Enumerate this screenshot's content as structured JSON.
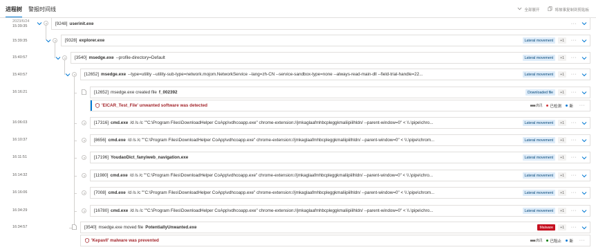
{
  "tabs": [
    {
      "label": "进程树",
      "active": true
    },
    {
      "label": "警报时间线",
      "active": false
    }
  ],
  "toolbar": {
    "expand_all": "全部展开",
    "copy_to_clipboard": "将故事复制到剪贴板"
  },
  "colors": {
    "accent": "#0078d4",
    "badge_bg": "#deecf9",
    "malware_badge": "#c50f1f",
    "alert_title": "#a4262c",
    "status_red": "#d13438",
    "status_green": "#107c10",
    "status_blue": "#0078d4"
  },
  "rows": [
    {
      "date": "2023/6/24",
      "time": "15:39:35",
      "pid": "[9248]",
      "name": "userinit.exe",
      "args": "",
      "badge": "",
      "plus": ""
    },
    {
      "time": "15:39:35",
      "pid": "[9328]",
      "name": "explorer.exe",
      "args": "",
      "badge": "Lateral movement",
      "plus": "+1"
    },
    {
      "time": "15:40:57",
      "pid": "[3540]",
      "name": "msedge.exe",
      "args": "--profile-directory=Default",
      "badge": "Lateral movement",
      "plus": "+1"
    },
    {
      "time": "15:40:57",
      "pid": "[12652]",
      "name": "msedge.exe",
      "args": "--type=utility --utility-sub-type=network.mojom.NetworkService --lang=zh-CN --service-sandbox-type=none --always-read-main-dll --field-trial-handle=22...",
      "badge": "Lateral movement",
      "plus": "+1"
    },
    {
      "time": "16:16:21",
      "pid": "[12652]",
      "name": "",
      "prefix": "msedge.exe created file",
      "target": "f_002392",
      "badge": "Downloaded file",
      "plus": "+1"
    },
    {
      "alert": true,
      "title": "'EICAR_Test_File' unwanted software was detected",
      "severity": "■■■ 高讯",
      "status": "已检测",
      "extra": "新"
    },
    {
      "time": "16:06:03",
      "pid": "[17316]",
      "name": "cmd.exe",
      "args": "/d /s /c \"\"C:\\Program Files\\DownloadHelper CoApp\\vdhcoapp.exe\" chrome-extension://jmkaglaafmhbcpleggkmaliipiilhldn/ --parent-window=0\" < \\\\.\\pipe\\chro...",
      "badge": "Lateral movement",
      "plus": "+1"
    },
    {
      "time": "16:10:37",
      "pid": "[8656]",
      "name": "cmd.exe",
      "args": "/d /s /c \"\"C:\\Program Files\\DownloadHelper CoApp\\vdhcoapp.exe\" chrome-extension://jmkaglaafmhbcpleggkmaliipiilhldn/ --parent-window=0\" < \\\\.\\pipe\\chrom...",
      "badge": "Lateral movement",
      "plus": "+1"
    },
    {
      "time": "16:11:51",
      "pid": "[17196]",
      "name": "YoudaoDict_fanyiweb_navigation.exe",
      "args": "",
      "badge": "Lateral movement",
      "plus": "+1"
    },
    {
      "time": "16:14:32",
      "pid": "[11980]",
      "name": "cmd.exe",
      "args": "/d /s /c \"\"C:\\Program Files\\DownloadHelper CoApp\\vdhcoapp.exe\" chrome-extension://jmkaglaafmhbcpleggkmaliipiilhldn/ --parent-window=0\" < \\\\.\\pipe\\chro...",
      "badge": "Lateral movement",
      "plus": "+1"
    },
    {
      "time": "16:16:06",
      "pid": "[7008]",
      "name": "cmd.exe",
      "args": "/d /s /c \"\"C:\\Program Files\\DownloadHelper CoApp\\vdhcoapp.exe\" chrome-extension://jmkaglaafmhbcpleggkmaliipiilhldn/ --parent-window=0\" < \\\\.\\pipe\\chrom...",
      "badge": "Lateral movement",
      "plus": "+1"
    },
    {
      "time": "16:34:29",
      "pid": "[16780]",
      "name": "cmd.exe",
      "args": "/d /s /c \"\"C:\\Program Files\\DownloadHelper CoApp\\vdhcoapp.exe\" chrome-extension://jmkaglaafmhbcpleggkmaliipiilhldn/ --parent-window=0\" < \\\\.\\pipe\\chro...",
      "badge": "Lateral movement",
      "plus": "+1"
    },
    {
      "time": "16:34:57",
      "pid": "[3540]",
      "name": "",
      "prefix": "msedge.exe moved file",
      "target": "PotentiallyUnwanted.exe",
      "badge": "Malware",
      "plus": "+1"
    },
    {
      "alert": true,
      "title": "'Kepavll' malware was prevented",
      "severity": "■■■ 高讯",
      "status": "已阻止",
      "extra": "新"
    }
  ]
}
